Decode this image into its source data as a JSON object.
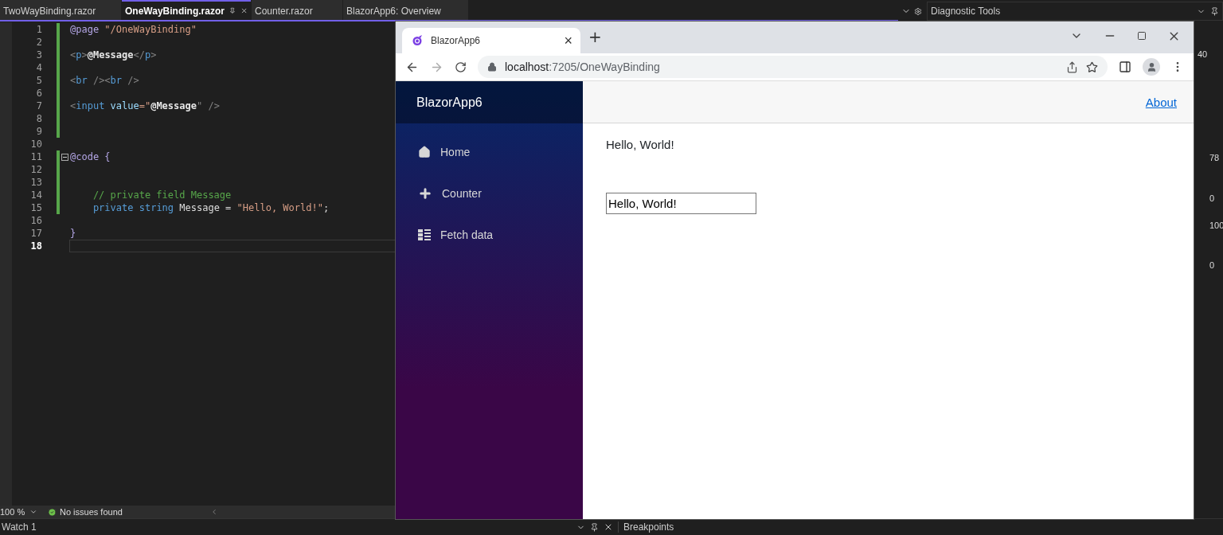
{
  "editor_tabs": [
    {
      "label": "TwoWayBinding.razor",
      "selected": false
    },
    {
      "label": "OneWayBinding.razor",
      "selected": true
    },
    {
      "label": "Counter.razor",
      "selected": false
    },
    {
      "label": "BlazorApp6: Overview",
      "selected": false
    }
  ],
  "code_lines": [
    {
      "number": "1",
      "modified": true,
      "current": false,
      "tokens": [
        {
          "t": "@page ",
          "kind": "directive"
        },
        {
          "t": "\"/OneWayBinding\"",
          "kind": "string"
        }
      ]
    },
    {
      "number": "2",
      "modified": true,
      "current": false
    },
    {
      "number": "3",
      "modified": true,
      "current": false,
      "tokens": [
        {
          "t": "<",
          "kind": "punct"
        },
        {
          "t": "p",
          "kind": "tag"
        },
        {
          "t": ">",
          "kind": "punct"
        },
        {
          "t": "@Message",
          "kind": "razor"
        },
        {
          "t": "</",
          "kind": "punct"
        },
        {
          "t": "p",
          "kind": "tag"
        },
        {
          "t": ">",
          "kind": "punct"
        }
      ]
    },
    {
      "number": "4",
      "modified": true,
      "current": false
    },
    {
      "number": "5",
      "modified": true,
      "current": false,
      "tokens": [
        {
          "t": "<",
          "kind": "punct"
        },
        {
          "t": "br",
          "kind": "tag"
        },
        {
          "t": " /><",
          "kind": "punct"
        },
        {
          "t": "br",
          "kind": "tag"
        },
        {
          "t": " />",
          "kind": "punct"
        }
      ]
    },
    {
      "number": "6",
      "modified": true,
      "current": false
    },
    {
      "number": "7",
      "modified": true,
      "current": false,
      "tokens": [
        {
          "t": "<",
          "kind": "punct"
        },
        {
          "t": "input ",
          "kind": "tag"
        },
        {
          "t": "value",
          "kind": "attr"
        },
        {
          "t": "=\"",
          "kind": "string"
        },
        {
          "t": "@Message",
          "kind": "razor"
        },
        {
          "t": "\" />",
          "kind": "punct"
        }
      ]
    },
    {
      "number": "8",
      "modified": true,
      "current": false
    },
    {
      "number": "9",
      "modified": true,
      "current": false
    },
    {
      "number": "10",
      "modified": false,
      "current": false
    },
    {
      "number": "11",
      "modified": true,
      "current": false,
      "fold": true,
      "tokens": [
        {
          "t": "@code ",
          "kind": "directive"
        },
        {
          "t": "{",
          "kind": "directive"
        }
      ]
    },
    {
      "number": "12",
      "modified": true,
      "current": false
    },
    {
      "number": "13",
      "modified": true,
      "current": false
    },
    {
      "number": "14",
      "modified": true,
      "current": false,
      "tokens": [
        {
          "t": "    // private field Message",
          "kind": "comment"
        }
      ]
    },
    {
      "number": "15",
      "modified": true,
      "current": false,
      "tokens": [
        {
          "t": "    private ",
          "kind": "keyword"
        },
        {
          "t": "string ",
          "kind": "keyword"
        },
        {
          "t": "Message = ",
          "kind": "ident"
        },
        {
          "t": "\"Hello, World!\"",
          "kind": "string"
        },
        {
          "t": ";",
          "kind": "ident"
        }
      ]
    },
    {
      "number": "16",
      "modified": false,
      "current": false
    },
    {
      "number": "17",
      "modified": false,
      "current": false,
      "tokens": [
        {
          "t": "}",
          "kind": "directive"
        }
      ]
    },
    {
      "number": "18",
      "modified": false,
      "current": true
    }
  ],
  "status_bar": {
    "zoom": "100 %",
    "issues": "No issues found"
  },
  "diagnostic_tools": {
    "title": "Diagnostic Tools",
    "readings": [
      "40",
      "78",
      "0",
      "100",
      "0"
    ]
  },
  "bottom_panels": [
    "Watch 1",
    "Breakpoints"
  ],
  "browser": {
    "tabs": [
      {
        "label": "BlazorApp6",
        "selected": true
      }
    ],
    "tab_close": "×",
    "new_tab": "+",
    "address": {
      "host": "localhost",
      "path": ":7205/OneWayBinding"
    },
    "app": {
      "brand": "BlazorApp6",
      "nav": [
        {
          "label": "Home",
          "selected": false
        },
        {
          "label": "Counter",
          "selected": false
        },
        {
          "label": "Fetch data",
          "selected": false
        }
      ],
      "top_link": "About",
      "message": "Hello, World!",
      "input_value": "Hello, World!"
    }
  }
}
